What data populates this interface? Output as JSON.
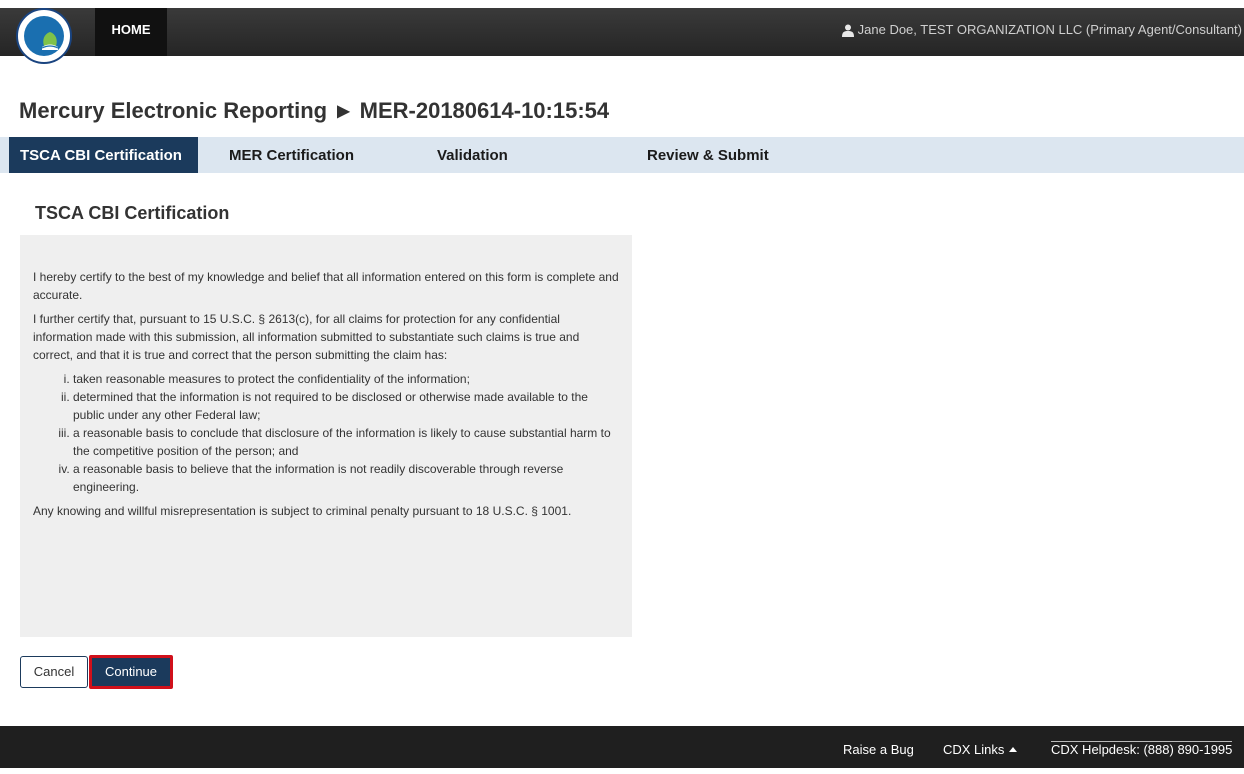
{
  "header": {
    "home_label": "HOME",
    "user_text": "Jane Doe, TEST ORGANIZATION LLC (Primary Agent/Consultant)"
  },
  "title": {
    "app": "Mercury Electronic Reporting",
    "separator": "▶",
    "record": "MER-20180614-10:15:54"
  },
  "tabs": [
    {
      "label": "TSCA CBI Certification",
      "active": true
    },
    {
      "label": "MER Certification",
      "active": false
    },
    {
      "label": "Validation",
      "active": false
    },
    {
      "label": "Review & Submit",
      "active": false
    }
  ],
  "section_title": "TSCA CBI Certification",
  "certification": {
    "para1": "I hereby certify to the best of my knowledge and belief that all information entered on this form is complete and accurate.",
    "para2": "I further certify that, pursuant to 15 U.S.C. § 2613(c), for all claims for protection for any confidential information made with this submission, all information submitted to substantiate such claims is true and correct, and that it is true and correct that the person submitting the claim has:",
    "items": [
      "taken reasonable measures to protect the confidentiality of the information;",
      "determined that the information is not required to be disclosed or otherwise made available to the public under any other Federal law;",
      "a reasonable basis to conclude that disclosure of the information is likely to cause substantial harm to the competitive position of the person; and",
      "a reasonable basis to believe that the information is not readily discoverable through reverse engineering."
    ],
    "para3": "Any knowing and willful misrepresentation is subject to criminal penalty pursuant to 18 U.S.C. § 1001."
  },
  "buttons": {
    "cancel": "Cancel",
    "continue": "Continue"
  },
  "footer": {
    "raise_bug": "Raise a Bug",
    "cdx_links": "CDX Links",
    "helpdesk": "CDX Helpdesk: (888) 890-1995"
  },
  "colors": {
    "nav_active": "#1b3a5c",
    "tab_bar": "#dce6f0",
    "highlight_border": "#d0101b"
  },
  "icons": [
    "epa-logo",
    "user-icon",
    "caret-up-icon"
  ]
}
